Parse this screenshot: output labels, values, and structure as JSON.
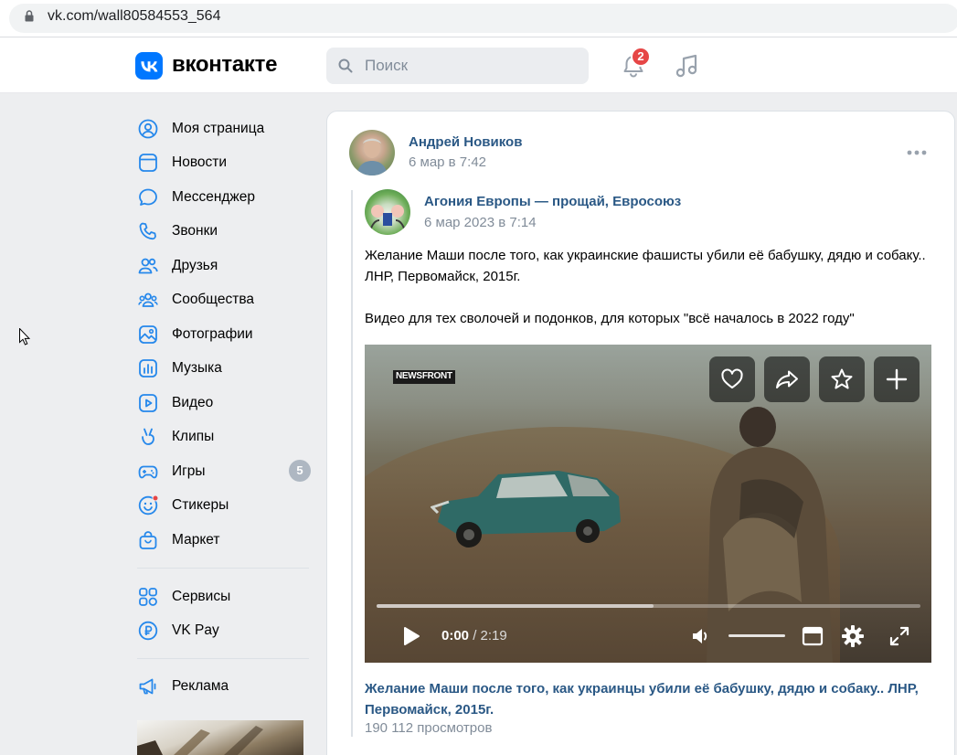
{
  "browser": {
    "url": "vk.com/wall80584553_564"
  },
  "header": {
    "logo_text": "вконтакте",
    "search_placeholder": "Поиск",
    "notifications_count": "2",
    "brand_color": "#0077ff"
  },
  "sidebar": {
    "items": [
      {
        "label": "Моя страница",
        "icon": "user-circle-icon"
      },
      {
        "label": "Новости",
        "icon": "news-icon"
      },
      {
        "label": "Мессенджер",
        "icon": "message-icon"
      },
      {
        "label": "Звонки",
        "icon": "phone-icon"
      },
      {
        "label": "Друзья",
        "icon": "friends-icon"
      },
      {
        "label": "Сообщества",
        "icon": "communities-icon"
      },
      {
        "label": "Фотографии",
        "icon": "photo-icon"
      },
      {
        "label": "Музыка",
        "icon": "music-chart-icon"
      },
      {
        "label": "Видео",
        "icon": "video-icon"
      },
      {
        "label": "Клипы",
        "icon": "clips-icon"
      },
      {
        "label": "Игры",
        "icon": "gamepad-icon",
        "count": "5"
      },
      {
        "label": "Стикеры",
        "icon": "smile-icon"
      },
      {
        "label": "Маркет",
        "icon": "bag-icon"
      },
      {
        "label": "Сервисы",
        "icon": "apps-icon"
      },
      {
        "label": "VK Pay",
        "icon": "ruble-icon"
      },
      {
        "label": "Реклама",
        "icon": "megaphone-icon"
      }
    ]
  },
  "post": {
    "author": "Андрей Новиков",
    "date": "6 мар в 7:42",
    "repost": {
      "group": "Агония Европы — прощай, Евросоюз",
      "date": "6 мар 2023 в 7:14",
      "text_1": "Желание Маши после того, как украинские фашисты убили её бабушку, дядю и собаку.. ЛНР, Первомайск, 2015г.",
      "text_2": "Видео для тех сволочей и подонков, для которых \"всё началось в 2022 году\""
    },
    "video": {
      "watermark_a": "NEWS",
      "watermark_b": "FRONT",
      "current_time": "0:00",
      "duration": "/ 2:19",
      "buffered": 0.51,
      "title": "Желание Маши после того, как украинцы убили её бабушку, дядю и собаку.. ЛНР, Первомайск, 2015г.",
      "views": "190 112 просмотров"
    }
  }
}
